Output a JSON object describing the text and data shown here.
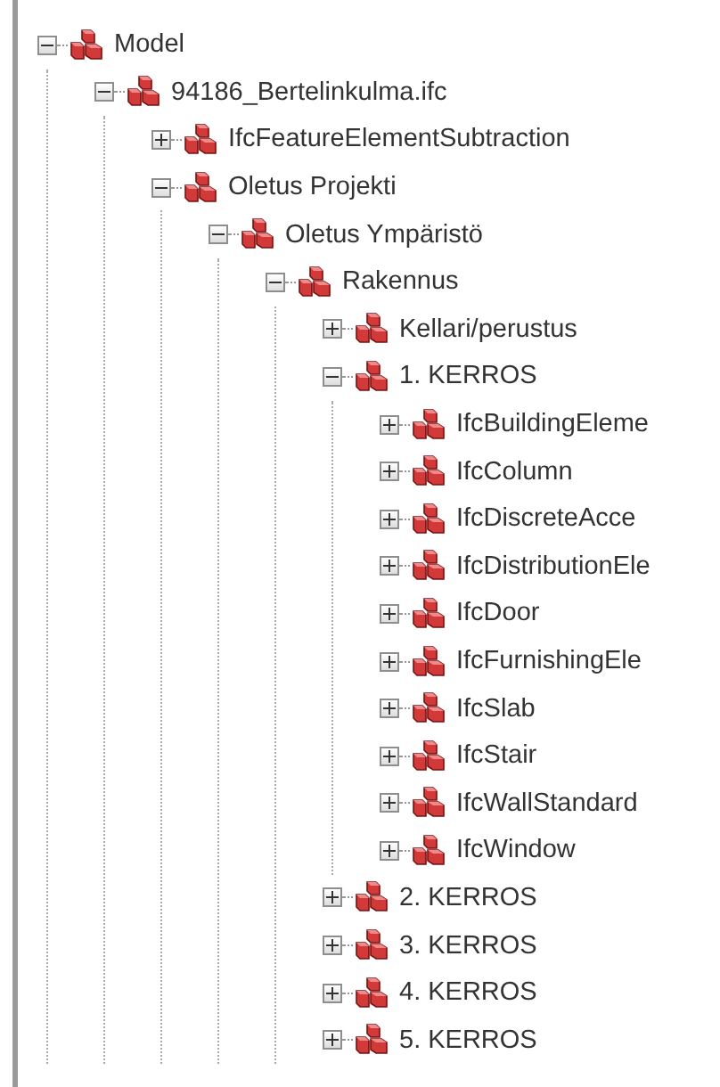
{
  "tree": [
    {
      "label": "Model",
      "expanded": true,
      "children": [
        {
          "label": "94186_Bertelinkulma.ifc",
          "expanded": true,
          "children": [
            {
              "label": "IfcFeatureElementSubtraction",
              "expanded": false
            },
            {
              "label": "Oletus Projekti",
              "expanded": true,
              "children": [
                {
                  "label": "Oletus Ympäristö",
                  "expanded": true,
                  "children": [
                    {
                      "label": "Rakennus",
                      "expanded": true,
                      "children": [
                        {
                          "label": "Kellari/perustus",
                          "expanded": false
                        },
                        {
                          "label": "1. KERROS",
                          "expanded": true,
                          "children": [
                            {
                              "label": "IfcBuildingEleme",
                              "expanded": false
                            },
                            {
                              "label": "IfcColumn",
                              "expanded": false
                            },
                            {
                              "label": "IfcDiscreteAcce",
                              "expanded": false
                            },
                            {
                              "label": "IfcDistributionEle",
                              "expanded": false
                            },
                            {
                              "label": "IfcDoor",
                              "expanded": false
                            },
                            {
                              "label": "IfcFurnishingEle",
                              "expanded": false
                            },
                            {
                              "label": "IfcSlab",
                              "expanded": false
                            },
                            {
                              "label": "IfcStair",
                              "expanded": false
                            },
                            {
                              "label": "IfcWallStandard",
                              "expanded": false
                            },
                            {
                              "label": "IfcWindow",
                              "expanded": false
                            }
                          ]
                        },
                        {
                          "label": "2. KERROS",
                          "expanded": false
                        },
                        {
                          "label": "3. KERROS",
                          "expanded": false
                        },
                        {
                          "label": "4. KERROS",
                          "expanded": false
                        },
                        {
                          "label": "5. KERROS",
                          "expanded": false
                        }
                      ]
                    }
                  ]
                }
              ]
            }
          ]
        }
      ]
    }
  ]
}
